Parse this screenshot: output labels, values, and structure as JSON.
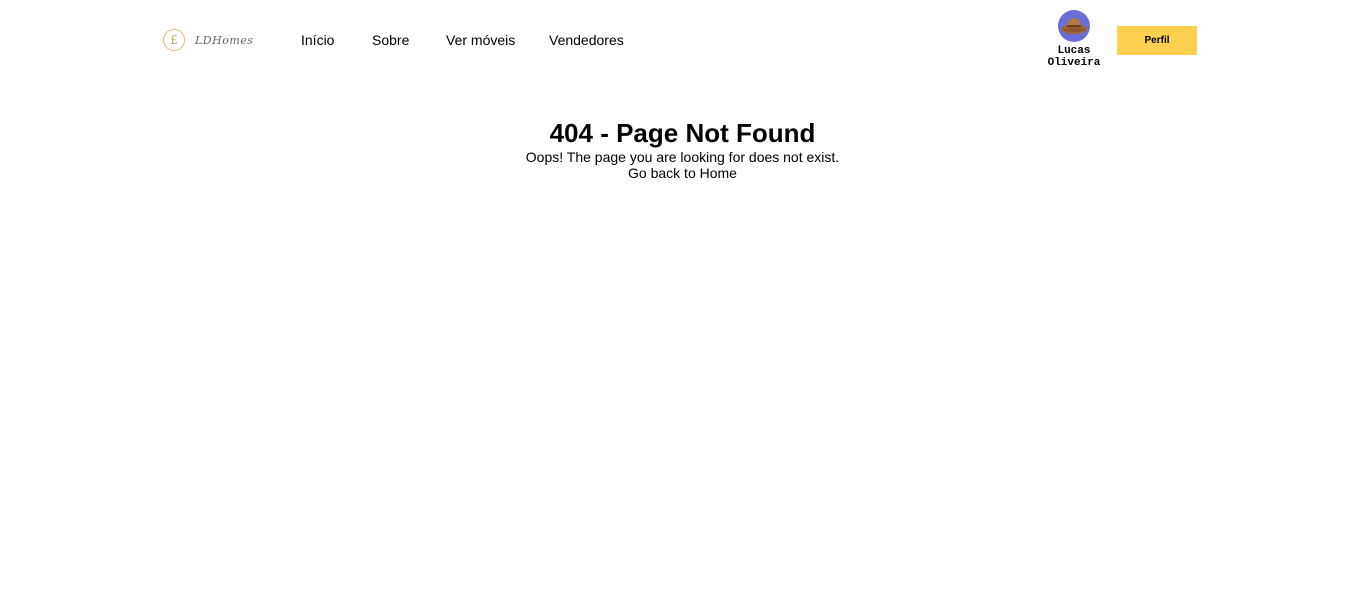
{
  "header": {
    "logo": {
      "mark": "£",
      "text": "LDHomes"
    },
    "nav": [
      {
        "label": "Início"
      },
      {
        "label": "Sobre"
      },
      {
        "label": "Ver móveis"
      },
      {
        "label": "Vendedores"
      }
    ],
    "user": {
      "first_name": "Lucas",
      "last_name": "Oliveira",
      "avatar_icon": "cowboy-hat-avatar"
    },
    "profile_button": "Perfil"
  },
  "main": {
    "title": "404 - Page Not Found",
    "message": "Oops! The page you are looking for does not exist.",
    "home_link": "Go back to Home"
  },
  "colors": {
    "accent": "#fdd04f",
    "avatar_bg": "#6a6fd6",
    "logo_gold": "#d9a35a"
  }
}
